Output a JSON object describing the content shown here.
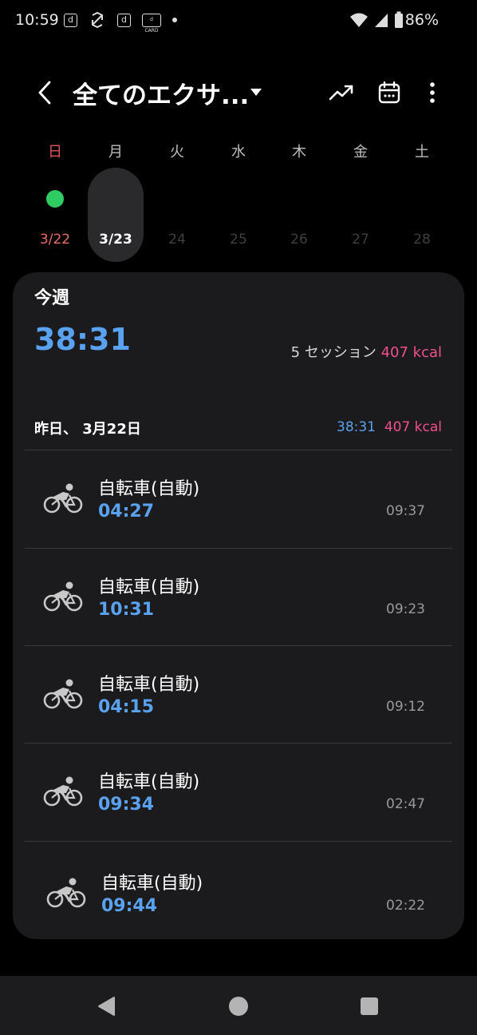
{
  "status_bar": {
    "time": "10:59",
    "battery": "86%",
    "icon_box_1": "d",
    "icon_box_2": "d",
    "icon_box_3": "d CARD"
  },
  "header": {
    "title": "全てのエクサ..."
  },
  "week": {
    "days": [
      {
        "label": "日",
        "date": "3/22",
        "has_activity": true
      },
      {
        "label": "月",
        "date": "3/23",
        "selected": true
      },
      {
        "label": "火",
        "date": "24"
      },
      {
        "label": "水",
        "date": "25"
      },
      {
        "label": "木",
        "date": "26"
      },
      {
        "label": "金",
        "date": "27"
      },
      {
        "label": "土",
        "date": "28"
      }
    ]
  },
  "summary": {
    "section_label": "今週",
    "total_duration": "38:31",
    "sessions": "5 セッション",
    "kcal": "407 kcal"
  },
  "day_group": {
    "label": "昨日、 3月22日",
    "duration": "38:31",
    "kcal": "407 kcal"
  },
  "exercises": [
    {
      "name": "自転車(自動)",
      "duration": "04:27",
      "time": "09:37",
      "icon": "cycling-icon"
    },
    {
      "name": "自転車(自動)",
      "duration": "10:31",
      "time": "09:23",
      "icon": "cycling-icon"
    },
    {
      "name": "自転車(自動)",
      "duration": "04:15",
      "time": "09:12",
      "icon": "cycling-icon"
    },
    {
      "name": "自転車(自動)",
      "duration": "09:34",
      "time": "02:47",
      "icon": "cycling-icon"
    },
    {
      "name": "自転車(自動)",
      "duration": "09:44",
      "time": "02:22",
      "icon": "cycling-icon"
    }
  ],
  "colors": {
    "accent_blue": "#5aa2ef",
    "kcal_pink": "#f0508c",
    "activity_green": "#2ecc63",
    "sunday_red": "#e0545a"
  }
}
